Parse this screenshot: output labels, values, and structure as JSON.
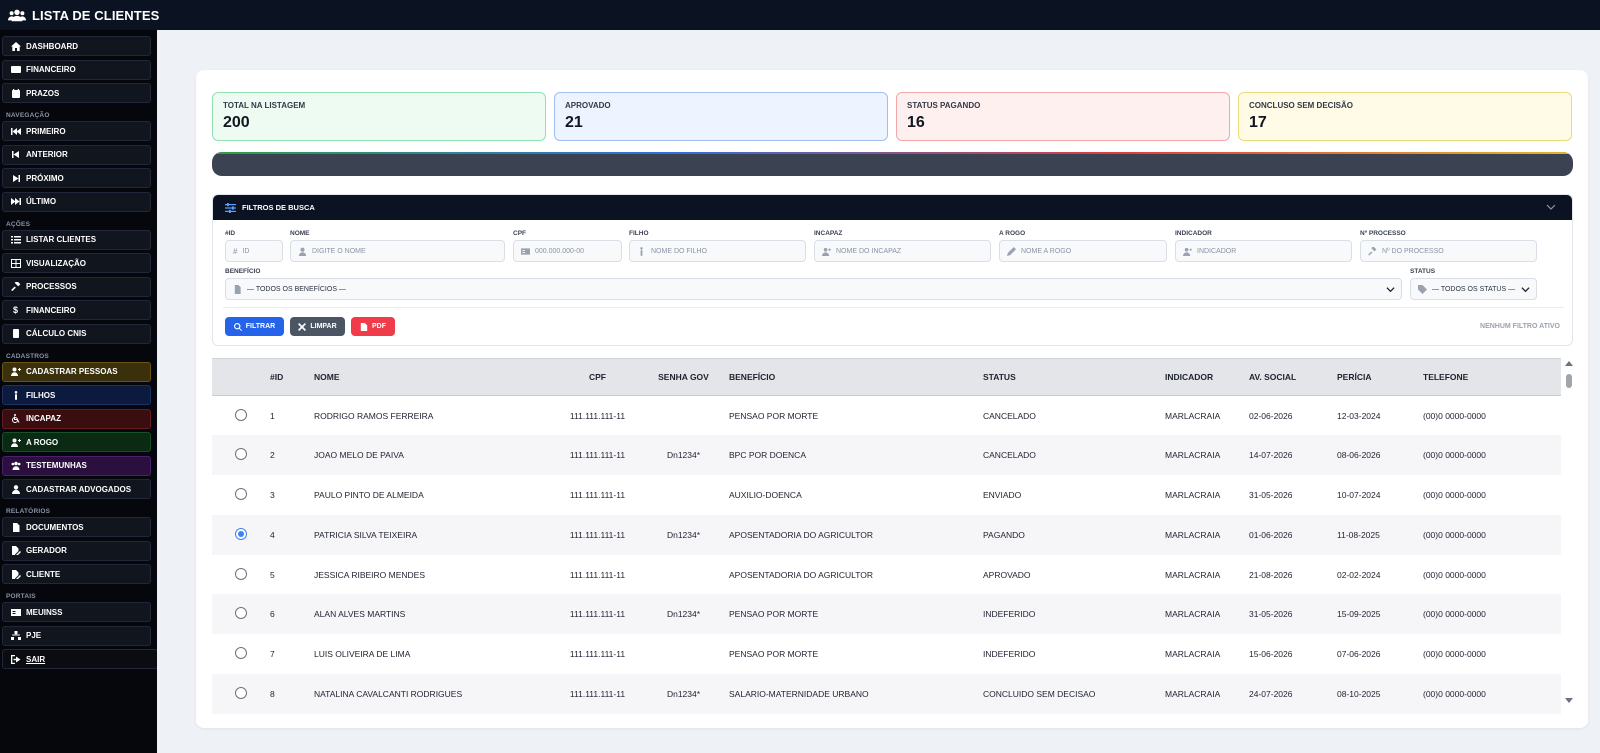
{
  "header": {
    "title": "LISTA DE CLIENTES"
  },
  "sidebar": {
    "top": [
      {
        "label": "DASHBOARD",
        "icon": "home-icon"
      },
      {
        "label": "FINANCEIRO",
        "icon": "wallet-icon"
      },
      {
        "label": "PRAZOS",
        "icon": "calendar-icon"
      }
    ],
    "nav_title": "NAVEGAÇÃO",
    "nav": [
      {
        "label": "PRIMEIRO",
        "icon": "first-icon"
      },
      {
        "label": "ANTERIOR",
        "icon": "previous-icon"
      },
      {
        "label": "PRÓXIMO",
        "icon": "next-icon"
      },
      {
        "label": "ÚLTIMO",
        "icon": "last-icon"
      }
    ],
    "actions_title": "AÇÕES",
    "actions": [
      {
        "label": "LISTAR CLIENTES",
        "icon": "list-icon"
      },
      {
        "label": "VISUALIZAÇÃO",
        "icon": "table-icon"
      },
      {
        "label": "PROCESSOS",
        "icon": "gavel-icon"
      },
      {
        "label": "FINANCEIRO",
        "icon": "dollar-icon"
      },
      {
        "label": "CÁLCULO CNIS",
        "icon": "calculator-icon"
      }
    ],
    "register_title": "CADASTROS",
    "register": [
      {
        "label": "CADASTRAR PESSOAS",
        "icon": "user-plus-icon"
      },
      {
        "label": "FILHOS",
        "icon": "child-icon"
      },
      {
        "label": "INCAPAZ",
        "icon": "wheelchair-icon"
      },
      {
        "label": "A ROGO",
        "icon": "user-plus-icon"
      },
      {
        "label": "TESTEMUNHAS",
        "icon": "users-icon"
      },
      {
        "label": "CADASTRAR ADVOGADOS",
        "icon": "user-icon"
      }
    ],
    "reports_title": "RELATÓRIOS",
    "reports": [
      {
        "label": "DOCUMENTOS",
        "icon": "file-icon"
      },
      {
        "label": "GERADOR",
        "icon": "file-edit-icon"
      },
      {
        "label": "CLIENTE",
        "icon": "file-edit-icon"
      }
    ],
    "portals_title": "PORTAIS",
    "portals": [
      {
        "label": "MEUINSS",
        "icon": "id-card-icon"
      },
      {
        "label": "PJE",
        "icon": "network-icon"
      },
      {
        "label": "SAIR",
        "icon": "logout-icon"
      }
    ]
  },
  "stats": [
    {
      "label": "TOTAL NA LISTAGEM",
      "value": "200",
      "color": "#93e0b3"
    },
    {
      "label": "APROVADO",
      "value": "21",
      "color": "#9ebff0"
    },
    {
      "label": "STATUS PAGANDO",
      "value": "16",
      "color": "#f0a8a8"
    },
    {
      "label": "CONCLUSO SEM DECISÃO",
      "value": "17",
      "color": "#efd97a"
    }
  ],
  "filters": {
    "title": "FILTROS DE BUSCA",
    "fields": [
      {
        "label": "#ID",
        "placeholder": "ID"
      },
      {
        "label": "NOME",
        "placeholder": "DIGITE O NOME"
      },
      {
        "label": "CPF",
        "placeholder": "000.000.000-00"
      },
      {
        "label": "FILHO",
        "placeholder": "NOME DO FILHO"
      },
      {
        "label": "INCAPAZ",
        "placeholder": "NOME DO INCAPAZ"
      },
      {
        "label": "A ROGO",
        "placeholder": "NOME A ROGO"
      },
      {
        "label": "INDICADOR",
        "placeholder": "INDICADOR"
      },
      {
        "label": "Nº PROCESSO",
        "placeholder": "Nº DO PROCESSO"
      }
    ],
    "beneficio_label": "BENEFÍCIO",
    "beneficio_value": "— TODOS OS BENEFÍCIOS —",
    "status_label": "STATUS",
    "status_value": "— TODOS OS STATUS —",
    "buttons": {
      "filter": "FILTRAR",
      "clear": "LIMPAR",
      "pdf": "PDF"
    },
    "active_text": "NENHUM FILTRO ATIVO"
  },
  "table": {
    "columns": [
      "#ID",
      "NOME",
      "CPF",
      "SENHA GOV",
      "BENEFÍCIO",
      "STATUS",
      "INDICADOR",
      "AV. SOCIAL",
      "PERÍCIA",
      "TELEFONE"
    ],
    "rows": [
      {
        "id": "1",
        "nome": "RODRIGO RAMOS FERREIRA",
        "cpf": "111.111.111-11",
        "senha": "",
        "beneficio": "PENSAO POR MORTE",
        "status": "CANCELADO",
        "indicador": "MARLACRAIA",
        "av_social": "02-06-2026",
        "pericia": "12-03-2024",
        "telefone": "(00)0 0000-0000",
        "selected": false
      },
      {
        "id": "2",
        "nome": "JOAO MELO DE PAIVA",
        "cpf": "111.111.111-11",
        "senha": "Dn1234*",
        "beneficio": "BPC POR DOENCA",
        "status": "CANCELADO",
        "indicador": "MARLACRAIA",
        "av_social": "14-07-2026",
        "pericia": "08-06-2026",
        "telefone": "(00)0 0000-0000",
        "selected": false
      },
      {
        "id": "3",
        "nome": "PAULO PINTO DE ALMEIDA",
        "cpf": "111.111.111-11",
        "senha": "",
        "beneficio": "AUXILIO-DOENCA",
        "status": "ENVIADO",
        "indicador": "MARLACRAIA",
        "av_social": "31-05-2026",
        "pericia": "10-07-2024",
        "telefone": "(00)0 0000-0000",
        "selected": false
      },
      {
        "id": "4",
        "nome": "PATRICIA SILVA TEIXEIRA",
        "cpf": "111.111.111-11",
        "senha": "Dn1234*",
        "beneficio": "APOSENTADORIA DO AGRICULTOR",
        "status": "PAGANDO",
        "indicador": "MARLACRAIA",
        "av_social": "01-06-2026",
        "pericia": "11-08-2025",
        "telefone": "(00)0 0000-0000",
        "selected": true
      },
      {
        "id": "5",
        "nome": "JESSICA RIBEIRO MENDES",
        "cpf": "111.111.111-11",
        "senha": "",
        "beneficio": "APOSENTADORIA DO AGRICULTOR",
        "status": "APROVADO",
        "indicador": "MARLACRAIA",
        "av_social": "21-08-2026",
        "pericia": "02-02-2024",
        "telefone": "(00)0 0000-0000",
        "selected": false
      },
      {
        "id": "6",
        "nome": "ALAN ALVES MARTINS",
        "cpf": "111.111.111-11",
        "senha": "Dn1234*",
        "beneficio": "PENSAO POR MORTE",
        "status": "INDEFERIDO",
        "indicador": "MARLACRAIA",
        "av_social": "31-05-2026",
        "pericia": "15-09-2025",
        "telefone": "(00)0 0000-0000",
        "selected": false
      },
      {
        "id": "7",
        "nome": "LUIS OLIVEIRA DE LIMA",
        "cpf": "111.111.111-11",
        "senha": "",
        "beneficio": "PENSAO POR MORTE",
        "status": "INDEFERIDO",
        "indicador": "MARLACRAIA",
        "av_social": "15-06-2026",
        "pericia": "07-06-2026",
        "telefone": "(00)0 0000-0000",
        "selected": false
      },
      {
        "id": "8",
        "nome": "NATALINA CAVALCANTI RODRIGUES",
        "cpf": "111.111.111-11",
        "senha": "Dn1234*",
        "beneficio": "SALARIO-MATERNIDADE URBANO",
        "status": "CONCLUIDO SEM DECISAO",
        "indicador": "MARLACRAIA",
        "av_social": "24-07-2026",
        "pericia": "08-10-2025",
        "telefone": "(00)0 0000-0000",
        "selected": false
      }
    ]
  }
}
